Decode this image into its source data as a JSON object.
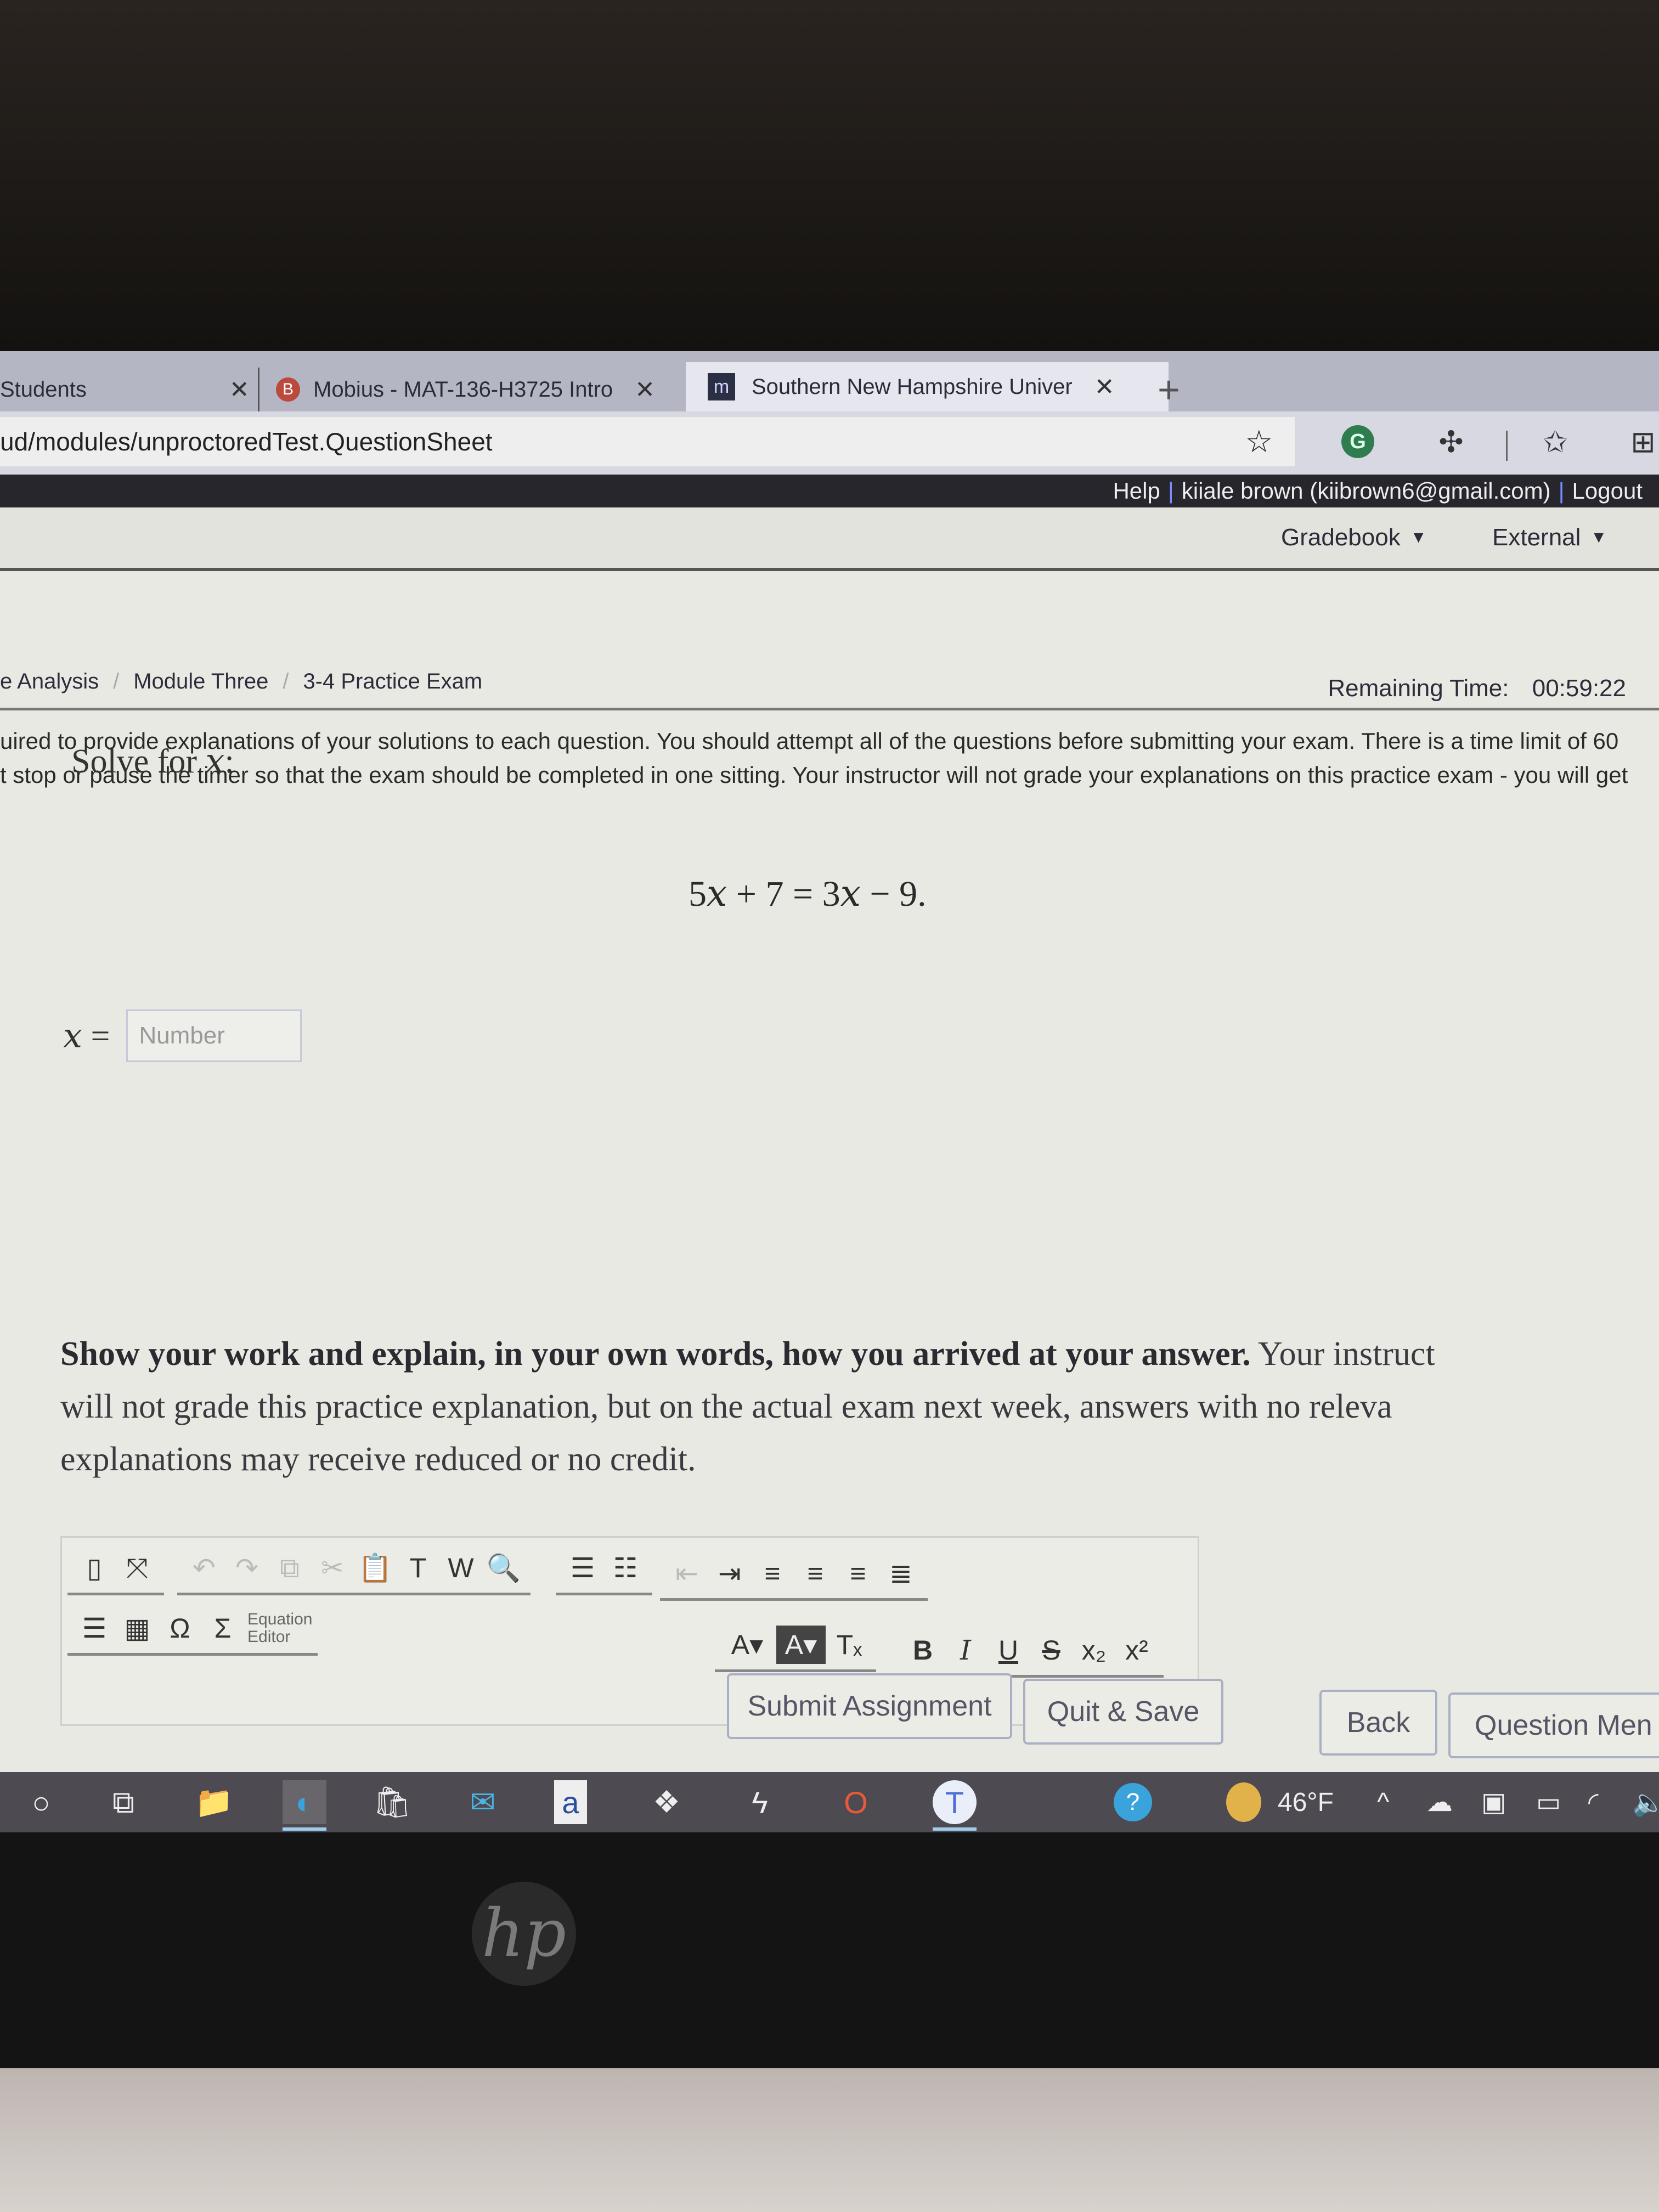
{
  "browser": {
    "tabs": [
      {
        "label": "Students",
        "favicon": "none",
        "active": false
      },
      {
        "label": "Mobius - MAT-136-H3725 Intro",
        "favicon": "mobius-b-icon",
        "active": false
      },
      {
        "label": "Southern New Hampshire Univer",
        "favicon": "snhu-m-icon",
        "active": true
      }
    ],
    "close_glyph": "✕",
    "new_tab_glyph": "+",
    "url": "ud/modules/unproctoredTest.QuestionSheet",
    "toolbar_icons": [
      "add-favorite-icon",
      "grammarly-icon",
      "extensions-icon",
      "favorites-icon",
      "collections-icon"
    ],
    "grammarly_letter": "G"
  },
  "userbar": {
    "help": "Help",
    "user": "kiiale brown (kiibrown6@gmail.com)",
    "logout": "Logout",
    "separator": "|"
  },
  "nav": {
    "items": [
      {
        "label": "Gradebook",
        "has_dropdown": true
      },
      {
        "label": "External",
        "has_dropdown": true
      }
    ]
  },
  "breadcrumb": {
    "items": [
      "e Analysis",
      "Module Three",
      "3-4 Practice Exam"
    ],
    "separator": "/"
  },
  "timer": {
    "label": "Remaining Time:",
    "value": "00:59:22"
  },
  "instructions": {
    "lines": [
      "uired to provide explanations of your solutions to each question. You should attempt all of the questions before submitting your exam. There is a time limit of 60",
      "t stop or pause the timer so that the exam should be completed in one sitting. Your instructor will not grade your explanations on this practice exam - you will get"
    ]
  },
  "question": {
    "prompt_text": "Solve for ",
    "prompt_var": "x",
    "prompt_end": ":",
    "equation": {
      "lhs_coef": "5",
      "var": "x",
      "lhs_rest": " + 7 = 3",
      "rhs_rest": " − 9."
    },
    "answer_var": "x",
    "answer_eq": " =",
    "answer_placeholder": "Number",
    "answer_value": ""
  },
  "explain": {
    "bold": "Show your work and explain, in your own words, how you arrived at your answer.",
    "line1_rest": " Your instruct",
    "line2": "will not grade this practice explanation, but on the actual exam next week, answers with no releva",
    "line3": "explanations may receive reduced or no credit."
  },
  "editor": {
    "row1": [
      {
        "name": "source-icon",
        "glyph": "▯",
        "disabled": false
      },
      {
        "name": "maximize-icon",
        "glyph": "⤧",
        "disabled": false
      },
      {
        "name": "undo-icon",
        "glyph": "↶",
        "disabled": true
      },
      {
        "name": "redo-icon",
        "glyph": "↷",
        "disabled": true
      },
      {
        "name": "copy-icon",
        "glyph": "⧉",
        "disabled": true
      },
      {
        "name": "cut-icon",
        "glyph": "✂",
        "disabled": true
      },
      {
        "name": "paste-icon",
        "glyph": "📋",
        "disabled": false
      },
      {
        "name": "paste-text-icon",
        "glyph": "T",
        "disabled": false
      },
      {
        "name": "paste-word-icon",
        "glyph": "W",
        "disabled": false
      },
      {
        "name": "find-icon",
        "glyph": "🔍",
        "disabled": false
      },
      {
        "name": "numbered-list-icon",
        "glyph": "☰",
        "disabled": false
      },
      {
        "name": "bulleted-list-icon",
        "glyph": "☷",
        "disabled": false
      },
      {
        "name": "outdent-icon",
        "glyph": "⇤",
        "disabled": true
      },
      {
        "name": "indent-icon",
        "glyph": "⇥",
        "disabled": false
      },
      {
        "name": "align-left-icon",
        "glyph": "≡",
        "disabled": false
      },
      {
        "name": "align-center-icon",
        "glyph": "≡",
        "disabled": false
      },
      {
        "name": "align-right-icon",
        "glyph": "≡",
        "disabled": false
      },
      {
        "name": "justify-icon",
        "glyph": "≣",
        "disabled": false
      }
    ],
    "row2_left": [
      {
        "name": "horizontal-rule-icon",
        "glyph": "☰"
      },
      {
        "name": "table-icon",
        "glyph": "▦"
      },
      {
        "name": "special-char-icon",
        "glyph": "Ω"
      },
      {
        "name": "equation-icon",
        "glyph": "Σ"
      }
    ],
    "equation_label_1": "Equation",
    "equation_label_2": "Editor",
    "row2_right": [
      {
        "name": "text-color-icon",
        "glyph": "A▾"
      },
      {
        "name": "background-color-icon",
        "glyph": "A▾"
      },
      {
        "name": "remove-format-icon",
        "glyph": "Tₓ"
      },
      {
        "name": "bold-icon",
        "glyph": "B"
      },
      {
        "name": "italic-icon",
        "glyph": "I"
      },
      {
        "name": "underline-icon",
        "glyph": "U"
      },
      {
        "name": "strikethrough-icon",
        "glyph": "S"
      },
      {
        "name": "subscript-icon",
        "glyph": "x₂"
      },
      {
        "name": "superscript-icon",
        "glyph": "x²"
      }
    ]
  },
  "actions": {
    "submit": "Submit Assignment",
    "quit_save": "Quit & Save",
    "back": "Back",
    "question_menu": "Question Men"
  },
  "taskbar": {
    "apps": [
      {
        "name": "search-icon",
        "glyph": "○"
      },
      {
        "name": "task-view-icon",
        "glyph": "⧉"
      },
      {
        "name": "file-explorer-icon",
        "glyph": "📁"
      },
      {
        "name": "edge-icon",
        "glyph": "◐",
        "active": true
      },
      {
        "name": "store-icon",
        "glyph": "🛍"
      },
      {
        "name": "mail-icon",
        "glyph": "✉"
      },
      {
        "name": "amazon-icon",
        "glyph": "a"
      },
      {
        "name": "dropbox-icon",
        "glyph": "❖"
      },
      {
        "name": "power-automate-icon",
        "glyph": "ϟ"
      },
      {
        "name": "office-icon",
        "glyph": "O"
      },
      {
        "name": "teams-icon",
        "glyph": "T",
        "active": true
      }
    ],
    "help_icon": "?",
    "weather_temp": "46°F",
    "tray_chevron": "^"
  },
  "colors": {
    "grammarly": "#2f7d4e",
    "mobius_badge": "#b94a3c",
    "taskbar": "#4e4a52",
    "userbar": "#26262c"
  }
}
